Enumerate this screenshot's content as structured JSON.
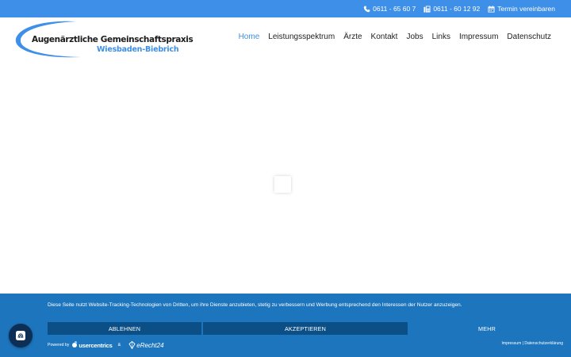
{
  "topbar": {
    "phone": "0611 - 65 60 7",
    "fax": "0611 - 60 12 92",
    "appointment": "Termin vereinbaren"
  },
  "logo": {
    "line1": "Augenärztliche Gemeinschaftspraxis",
    "line2": "Wiesbaden-Biebrich"
  },
  "nav": {
    "items": [
      "Home",
      "Leistungsspektrum",
      "Ärzte",
      "Kontakt",
      "Jobs",
      "Links",
      "Impressum",
      "Datenschutz"
    ],
    "active": "Home"
  },
  "consent": {
    "text": "Diese Seite nutzt Website-Tracking-Technologien von Dritten, um ihre Dienste anzubieten, stetig zu verbessern und Werbung entsprechend den Interessen der Nutzer anzuzeigen.",
    "decline": "ABLEHNEN",
    "accept": "AKZEPTIEREN",
    "more": "MEHR",
    "powered_by": "Powered by",
    "usercentrics": "usercentrics",
    "amp": "&",
    "erecht": "eRecht24",
    "imprint": "Impressum",
    "separator": "|",
    "privacy": "Datenschutzerklärung"
  },
  "colors": {
    "accent": "#3d8fe8",
    "banner": "#1d76bd",
    "button": "#0b4f86",
    "privacy_button": "#0d2f55"
  },
  "icons": {
    "phone": "phone-icon",
    "fax": "fax-icon",
    "calendar": "calendar-icon",
    "privacy": "fingerprint-icon"
  }
}
